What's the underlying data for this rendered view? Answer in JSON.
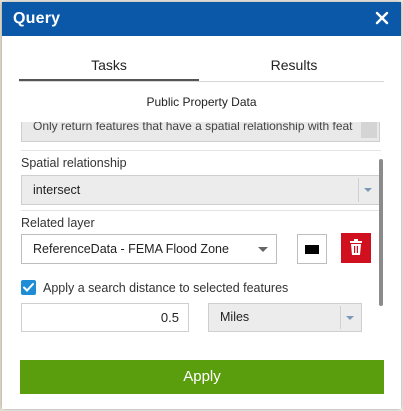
{
  "window": {
    "title": "Query"
  },
  "tabs": [
    {
      "label": "Tasks"
    },
    {
      "label": "Results"
    }
  ],
  "subtitle": "Public Property Data",
  "form": {
    "spatial_filter_text": "Only return features that have a spatial relationship with features in another layer",
    "spatial_relationship": {
      "label": "Spatial relationship",
      "value": "intersect"
    },
    "related_layer": {
      "label": "Related layer",
      "value": "ReferenceData - FEMA Flood Zone"
    },
    "buffer": {
      "checkbox_label": "Apply a search distance to selected features",
      "checked": true,
      "distance": "0.5",
      "unit": "Miles"
    }
  },
  "apply_button": {
    "label": "Apply"
  },
  "colors": {
    "header": "#0b57a8",
    "apply": "#5a9e0e",
    "delete": "#d0101f",
    "checkbox": "#1f8dd6",
    "swatch": "#000000"
  },
  "icons": [
    "close-icon",
    "chevron-down-icon",
    "trash-icon",
    "check-icon"
  ]
}
